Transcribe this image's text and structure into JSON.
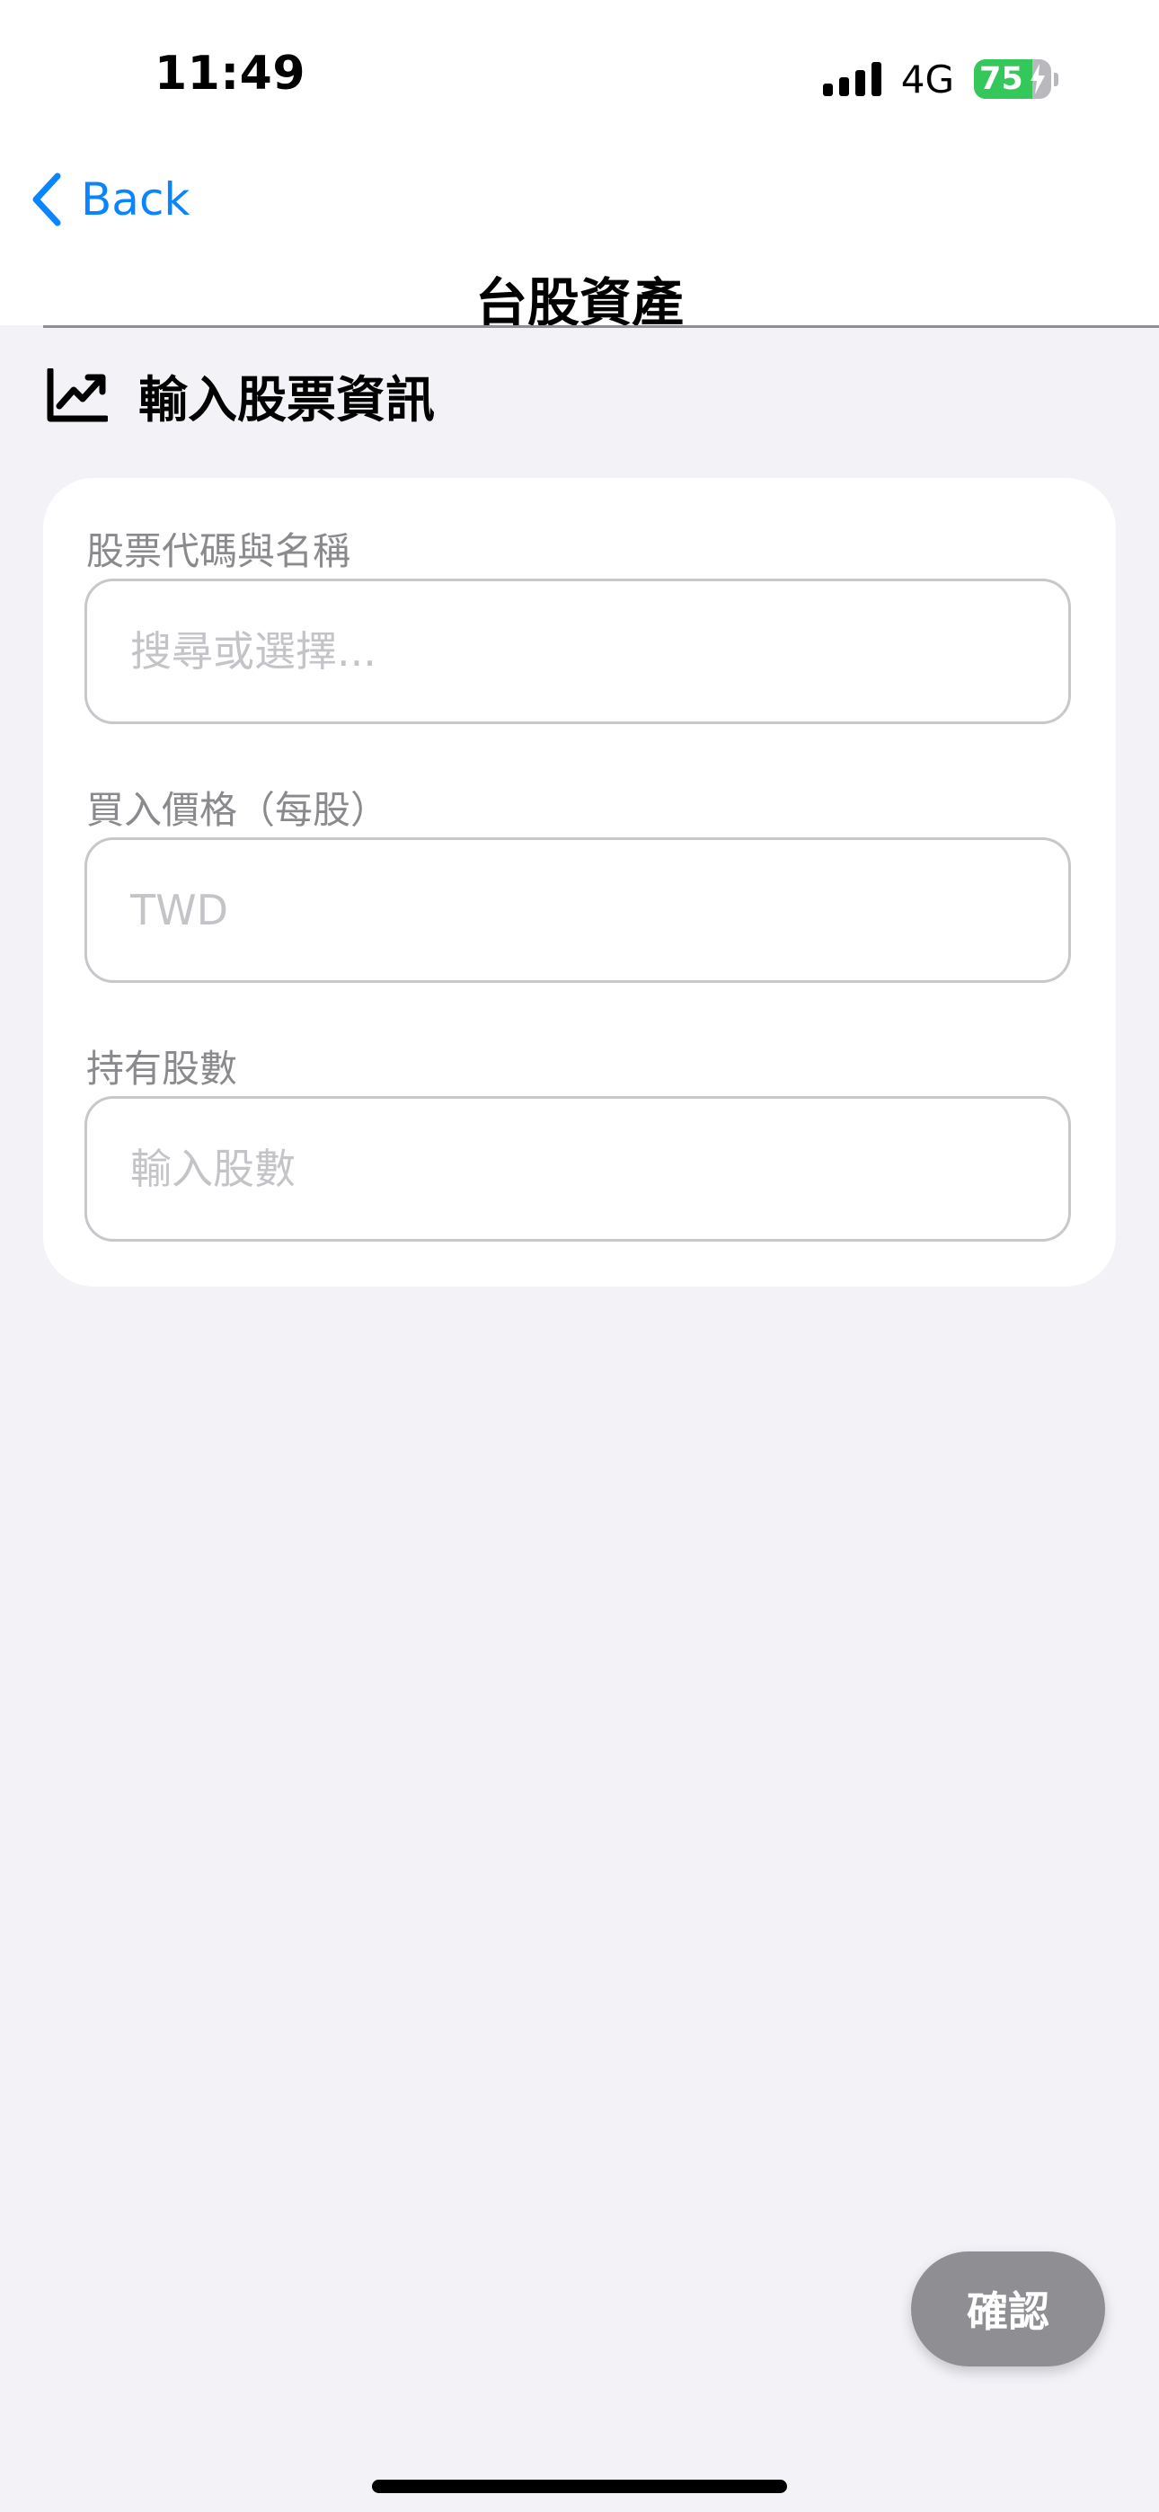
{
  "status_bar": {
    "time": "11:49",
    "network": "4G",
    "battery_percent": "75",
    "battery_level": 0.75,
    "signal_bars": 4,
    "battery_color": "#34c759"
  },
  "nav": {
    "back_label": "Back",
    "title": "台股資產"
  },
  "section": {
    "icon": "chart-line-uptrend-icon",
    "title": "輸入股票資訊"
  },
  "form": {
    "stock": {
      "label": "股票代碼與名稱",
      "placeholder": "搜尋或選擇...",
      "value": ""
    },
    "price": {
      "label": "買入價格（每股）",
      "placeholder": "TWD",
      "value": ""
    },
    "shares": {
      "label": "持有股數",
      "placeholder": "輸入股數",
      "value": ""
    }
  },
  "actions": {
    "confirm_label": "確認"
  },
  "colors": {
    "accent": "#0a84ff",
    "background": "#f2f2f7",
    "button_disabled": "#8e8e93"
  }
}
